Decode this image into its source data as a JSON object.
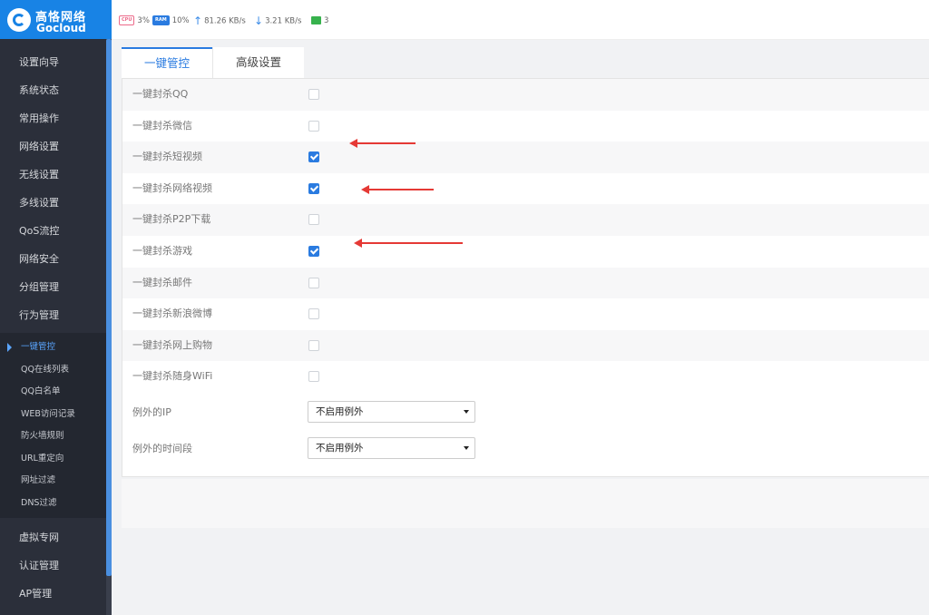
{
  "brand": {
    "name_cn": "高恪网络",
    "name_en": "Gocloud"
  },
  "status_bar": {
    "cpu_label": "CPU",
    "cpu": "3%",
    "ram_label": "RAM",
    "ram": "10%",
    "upload": "81.26 KB/s",
    "download": "3.21 KB/s",
    "devices": "3"
  },
  "sidebar": {
    "items_top": [
      "设置向导",
      "系统状态",
      "常用操作",
      "网络设置",
      "无线设置",
      "多线设置",
      "QoS流控",
      "网络安全",
      "分组管理",
      "行为管理"
    ],
    "sub_items": [
      "一键管控",
      "QQ在线列表",
      "QQ白名单",
      "WEB访问记录",
      "防火墙规则",
      "URL重定向",
      "网址过滤",
      "DNS过滤"
    ],
    "items_bottom": [
      "虚拟专网",
      "认证管理",
      "AP管理"
    ]
  },
  "tabs": {
    "active": "一键管控",
    "other": "高级设置"
  },
  "options": [
    {
      "label": "一键封杀QQ",
      "checked": false
    },
    {
      "label": "一键封杀微信",
      "checked": false
    },
    {
      "label": "一键封杀短视频",
      "checked": true
    },
    {
      "label": "一键封杀网络视频",
      "checked": true
    },
    {
      "label": "一键封杀P2P下载",
      "checked": false
    },
    {
      "label": "一键封杀游戏",
      "checked": true
    },
    {
      "label": "一键封杀邮件",
      "checked": false
    },
    {
      "label": "一键封杀新浪微博",
      "checked": false
    },
    {
      "label": "一键封杀网上购物",
      "checked": false
    },
    {
      "label": "一键封杀随身WiFi",
      "checked": false
    }
  ],
  "exceptions": {
    "ip_label": "例外的IP",
    "ip_value": "不启用例外",
    "time_label": "例外的时间段",
    "time_value": "不启用例外"
  },
  "colors": {
    "brand": "#1883e5",
    "accent": "#2a7be0",
    "annotation": "#e53935"
  }
}
